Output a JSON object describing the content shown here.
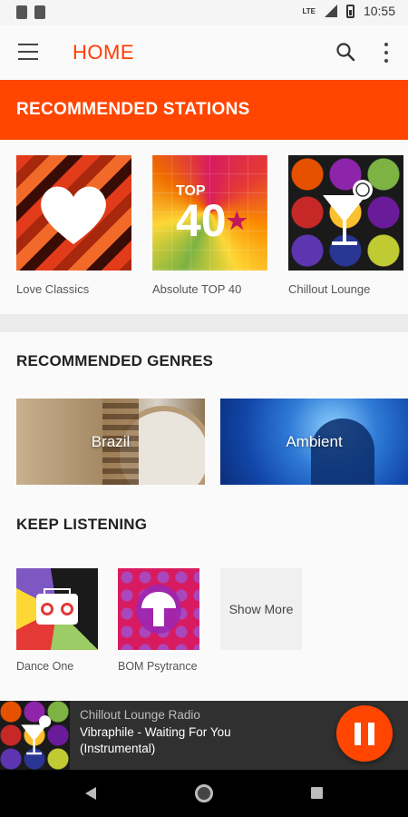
{
  "status_bar": {
    "time": "10:55",
    "network": "LTE"
  },
  "app_bar": {
    "title": "HOME"
  },
  "banner": {
    "title": "RECOMMENDED STATIONS"
  },
  "stations": [
    {
      "label": "Love Classics"
    },
    {
      "label": "Absolute TOP 40",
      "art_text": "TOP",
      "art_number": "40"
    },
    {
      "label": "Chillout Lounge"
    }
  ],
  "genres": {
    "title": "RECOMMENDED GENRES",
    "items": [
      {
        "label": "Brazil"
      },
      {
        "label": "Ambient"
      }
    ]
  },
  "keep_listening": {
    "title": "KEEP LISTENING",
    "items": [
      {
        "label": "Dance One"
      },
      {
        "label": "BOM Psytrance"
      }
    ],
    "show_more": "Show More"
  },
  "player": {
    "station": "Chillout Lounge Radio",
    "track": "Vibraphile - Waiting For You (Instrumental)"
  },
  "colors": {
    "accent": "#ff4500",
    "title_red": "#ff3d00",
    "player_bg": "#303030"
  },
  "icons": [
    "menu-icon",
    "search-icon",
    "more-vert-icon",
    "pause-icon",
    "back-icon",
    "home-icon",
    "recents-icon"
  ]
}
